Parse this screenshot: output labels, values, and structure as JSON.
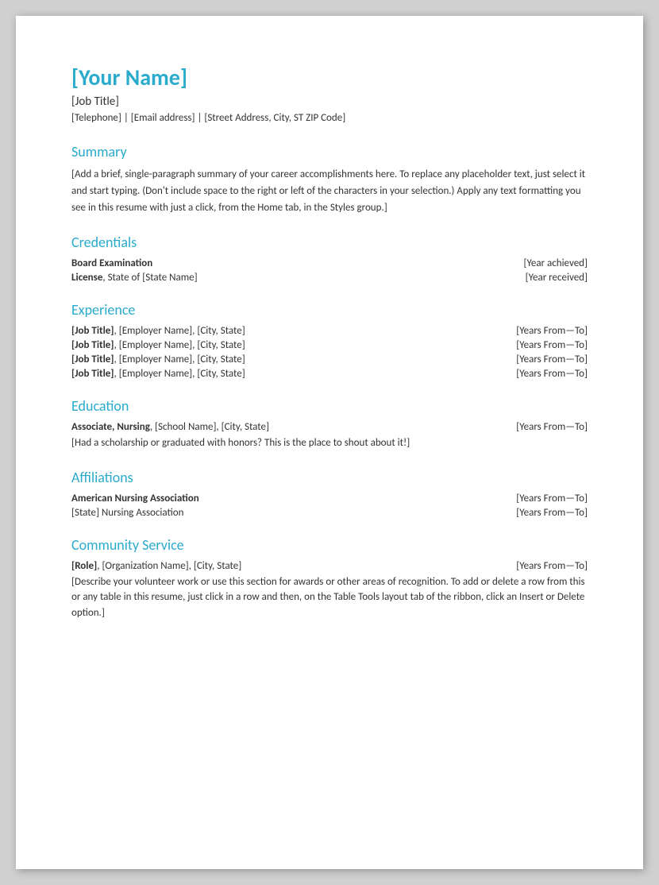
{
  "header": {
    "name": "[Your Name]",
    "job_title": "[Job Title]",
    "contact": "[Telephone]  |  [Email address]  |  [Street Address, City, ST ZIP Code]"
  },
  "summary": {
    "title": "Summary",
    "text": "[Add a brief, single-paragraph summary of your career accomplishments here. To replace any placeholder text, just select it and start typing. (Don't include space to the right or left of the characters in your selection.) Apply any text formatting you see in this resume with just a click, from the Home tab, in the Styles group.]"
  },
  "credentials": {
    "title": "Credentials",
    "items": [
      {
        "left_bold": "Board Examination",
        "left_normal": "",
        "right": "[Year achieved]"
      },
      {
        "left_bold": "License",
        "left_normal": ", State of [State Name]",
        "right": "[Year received]"
      }
    ]
  },
  "experience": {
    "title": "Experience",
    "items": [
      {
        "left_bold": "[Job Title]",
        "left_normal": ", [Employer Name], [City, State]",
        "right": "[Years From—To]"
      },
      {
        "left_bold": "[Job Title]",
        "left_normal": ", [Employer Name], [City, State]",
        "right": "[Years From—To]"
      },
      {
        "left_bold": "[Job Title]",
        "left_normal": ", [Employer Name], [City, State]",
        "right": "[Years From—To]"
      },
      {
        "left_bold": "[Job Title]",
        "left_normal": ", [Employer Name], [City, State]",
        "right": "[Years From—To]"
      }
    ]
  },
  "education": {
    "title": "Education",
    "items": [
      {
        "left_bold": "Associate, Nursing",
        "left_normal": ", [School Name], [City, State]",
        "right": "[Years From—To]"
      }
    ],
    "note": "[Had a scholarship or graduated with honors? This is the place to shout about it!]"
  },
  "affiliations": {
    "title": "Affiliations",
    "items": [
      {
        "left_bold": "American Nursing Association",
        "left_normal": "",
        "right": "[Years From—To]"
      },
      {
        "left_bold": "",
        "left_normal": "[State] Nursing Association",
        "right": "[Years From—To]"
      }
    ]
  },
  "community_service": {
    "title": "Community Service",
    "items": [
      {
        "left_bold": "[Role]",
        "left_normal": ", [Organization Name], [City, State]",
        "right": "[Years From—To]"
      }
    ],
    "note": "[Describe your volunteer work or use this section for awards or other areas of recognition. To add or delete a row from this or any table in this resume, just click in a row and then, on the Table Tools layout tab of the ribbon, click an Insert or Delete option.]"
  }
}
